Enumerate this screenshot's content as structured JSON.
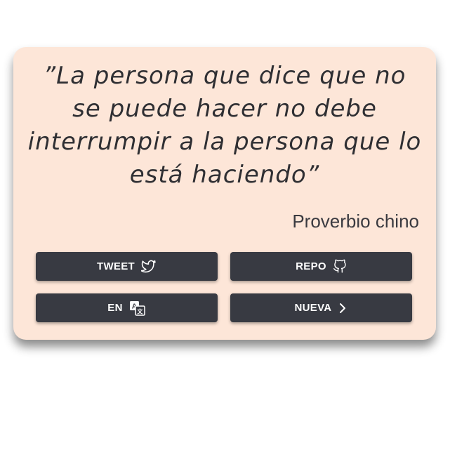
{
  "quote": {
    "text": "”La persona que dice que no se puede hacer no debe interrumpir a la persona que lo está haciendo”",
    "author": "Proverbio chino"
  },
  "buttons": {
    "tweet_label": "TWEET",
    "tweet_icon": "twitter-bird-icon",
    "repo_label": "REPO",
    "repo_icon": "github-icon",
    "lang_label": "EN",
    "lang_icon": "translate-icon",
    "new_label": "NUEVA",
    "new_icon": "chevron-right-icon"
  },
  "colors": {
    "card_background": "#fde6d8",
    "button_background": "#383a42",
    "button_text": "#ffffff",
    "quote_text": "#2f2f33"
  }
}
